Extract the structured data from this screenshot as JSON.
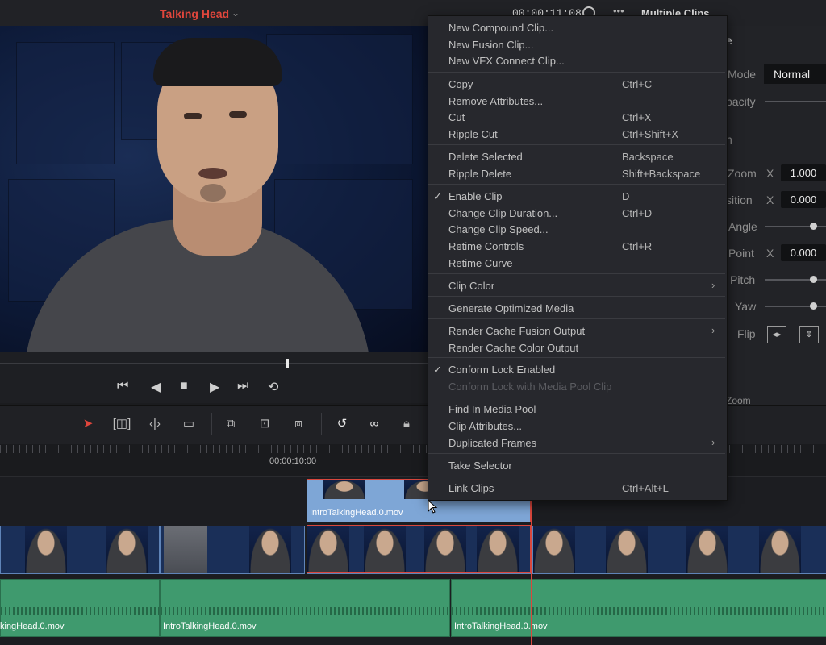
{
  "topbar": {
    "timeline_name": "Talking Head",
    "timecode": "00:00:11:08",
    "right_title": "Multiple Clips",
    "more": "•••"
  },
  "inspector": {
    "composite_mode_label": "Mode",
    "composite_mode_value": "Normal",
    "opacity_label": "pacity",
    "zoom_label": "Zoom",
    "zoom_x_label": "X",
    "zoom_x_value": "1.000",
    "position_label": "sition",
    "position_x_label": "X",
    "position_x_value": "0.000",
    "angle_label": "Angle",
    "anchor_label": "Point",
    "anchor_x_label": "X",
    "anchor_x_value": "0.000",
    "pitch_label": "Pitch",
    "yaw_label": "Yaw",
    "flip_label": "Flip",
    "title_fragment": "e",
    "sec_fragment": "n",
    "zoom_fragment": "Zoom"
  },
  "ruler": {
    "timecode": "00:00:10:00"
  },
  "tracks": {
    "v2_clip_name": "IntroTalkingHead.0.mov",
    "a1_clip_1_name": "kingHead.0.mov",
    "a1_clip_2_name": "IntroTalkingHead.0.mov",
    "a1_clip_3_name": "IntroTalkingHead.0.mov"
  },
  "context_menu": {
    "items": [
      {
        "label": "New Compound Clip...",
        "shortcut": "",
        "checked": false,
        "submenu": false,
        "disabled": false
      },
      {
        "label": "New Fusion Clip...",
        "shortcut": "",
        "checked": false,
        "submenu": false,
        "disabled": false
      },
      {
        "label": "New VFX Connect Clip...",
        "shortcut": "",
        "checked": false,
        "submenu": false,
        "disabled": false
      },
      {
        "label": "Copy",
        "shortcut": "Ctrl+C",
        "checked": false,
        "submenu": false,
        "disabled": false
      },
      {
        "label": "Remove Attributes...",
        "shortcut": "",
        "checked": false,
        "submenu": false,
        "disabled": false
      },
      {
        "label": "Cut",
        "shortcut": "Ctrl+X",
        "checked": false,
        "submenu": false,
        "disabled": false
      },
      {
        "label": "Ripple Cut",
        "shortcut": "Ctrl+Shift+X",
        "checked": false,
        "submenu": false,
        "disabled": false
      },
      {
        "label": "Delete Selected",
        "shortcut": "Backspace",
        "checked": false,
        "submenu": false,
        "disabled": false
      },
      {
        "label": "Ripple Delete",
        "shortcut": "Shift+Backspace",
        "checked": false,
        "submenu": false,
        "disabled": false
      },
      {
        "label": "Enable Clip",
        "shortcut": "D",
        "checked": true,
        "submenu": false,
        "disabled": false
      },
      {
        "label": "Change Clip Duration...",
        "shortcut": "Ctrl+D",
        "checked": false,
        "submenu": false,
        "disabled": false
      },
      {
        "label": "Change Clip Speed...",
        "shortcut": "",
        "checked": false,
        "submenu": false,
        "disabled": false
      },
      {
        "label": "Retime Controls",
        "shortcut": "Ctrl+R",
        "checked": false,
        "submenu": false,
        "disabled": false
      },
      {
        "label": "Retime Curve",
        "shortcut": "",
        "checked": false,
        "submenu": false,
        "disabled": false
      },
      {
        "label": "Clip Color",
        "shortcut": "",
        "checked": false,
        "submenu": true,
        "disabled": false
      },
      {
        "label": "Generate Optimized Media",
        "shortcut": "",
        "checked": false,
        "submenu": false,
        "disabled": false
      },
      {
        "label": "Render Cache Fusion Output",
        "shortcut": "",
        "checked": false,
        "submenu": true,
        "disabled": false
      },
      {
        "label": "Render Cache Color Output",
        "shortcut": "",
        "checked": false,
        "submenu": false,
        "disabled": false
      },
      {
        "label": "Conform Lock Enabled",
        "shortcut": "",
        "checked": true,
        "submenu": false,
        "disabled": false
      },
      {
        "label": "Conform Lock with Media Pool Clip",
        "shortcut": "",
        "checked": false,
        "submenu": false,
        "disabled": true
      },
      {
        "label": "Find In Media Pool",
        "shortcut": "",
        "checked": false,
        "submenu": false,
        "disabled": false
      },
      {
        "label": "Clip Attributes...",
        "shortcut": "",
        "checked": false,
        "submenu": false,
        "disabled": false
      },
      {
        "label": "Duplicated Frames",
        "shortcut": "",
        "checked": false,
        "submenu": true,
        "disabled": false
      },
      {
        "label": "Take Selector",
        "shortcut": "",
        "checked": false,
        "submenu": false,
        "disabled": false
      },
      {
        "label": "Link Clips",
        "shortcut": "Ctrl+Alt+L",
        "checked": false,
        "submenu": false,
        "disabled": false
      }
    ],
    "checkmark": "✓",
    "submenu_arrow": "›"
  },
  "colors": {
    "accent_red": "#e0463c",
    "video_clip": "#1a2f58",
    "video_clip_selected": "#7ea6d6",
    "audio_clip": "#3f9a6e",
    "menu_bg": "#27282d"
  },
  "icons": {
    "transport": [
      "skip-to-start-icon",
      "step-back-icon",
      "stop-icon",
      "play-icon",
      "skip-to-end-icon",
      "loop-icon"
    ],
    "tools": [
      "selection-arrow-icon",
      "trim-edit-icon",
      "dynamic-trim-icon",
      "blade-edit-icon",
      "insert-clip-icon",
      "overwrite-clip-icon",
      "replace-clip-icon",
      "snapping-icon",
      "linked-selection-icon",
      "position-lock-icon"
    ]
  }
}
